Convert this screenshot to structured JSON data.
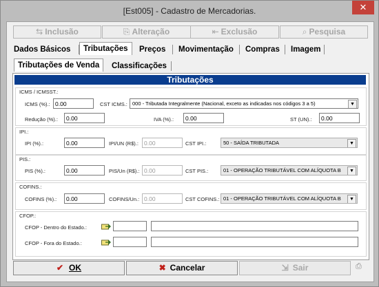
{
  "window": {
    "title": "[Est005] - Cadastro de Mercadorias."
  },
  "toolbar": {
    "inclusao": "Inclusão",
    "alteracao": "Alteração",
    "exclusao": "Exclusão",
    "pesquisa": "Pesquisa"
  },
  "tabs": [
    "Dados Básicos",
    "Tributações",
    "Preços",
    "Movimentação",
    "Compras",
    "Imagem"
  ],
  "subtabs": [
    "Tributações de Venda",
    "Classificações"
  ],
  "banner": "Tributações",
  "icms": {
    "group": "ICMS / ICMSST.:",
    "icms_label": "ICMS (%).:",
    "icms_value": "0.00",
    "cst_label": "CST ICMS.:",
    "cst_value": "000 - Tributada Integralmente (Nacional, exceto as indicadas nos códigos 3 a 5)",
    "reducao_label": "Redução (%).:",
    "reducao_value": "0.00",
    "iva_label": "IVA (%).:",
    "iva_value": "0.00",
    "st_label": "ST (UN).:",
    "st_value": "0.00"
  },
  "ipi": {
    "group": "IPI.:",
    "ipi_label": "IPI (%).:",
    "ipi_value": "0.00",
    "un_label": "IPI/UN (R$).:",
    "un_value": "0.00",
    "cst_label": "CST IPI.:",
    "cst_value": "50 - SAÍDA TRIBUTADA"
  },
  "pis": {
    "group": "PIS.:",
    "pis_label": "PIS (%).:",
    "pis_value": "0.00",
    "un_label": "PIS/Un (R$).:",
    "un_value": "0.00",
    "cst_label": "CST PIS.:",
    "cst_value": "01 - OPERAÇÃO TRIBUTÁVEL COM ALÍQUOTA B"
  },
  "cofins": {
    "group": "COFINS.:",
    "cofins_label": "COFINS (%).:",
    "cofins_value": "0.00",
    "un_label": "COFINS/Un.:",
    "un_value": "0.00",
    "cst_label": "CST COFINS.:",
    "cst_value": "01 - OPERAÇÃO TRIBUTÁVEL COM ALÍQUOTA B"
  },
  "cfop": {
    "group": "CFOP.:",
    "dentro_label": "CFOP - Dentro do Estado.:",
    "fora_label": "CFOP - Fora do Estado.:"
  },
  "footer": {
    "ok": "OK",
    "cancelar": "Cancelar",
    "sair": "Sair"
  }
}
